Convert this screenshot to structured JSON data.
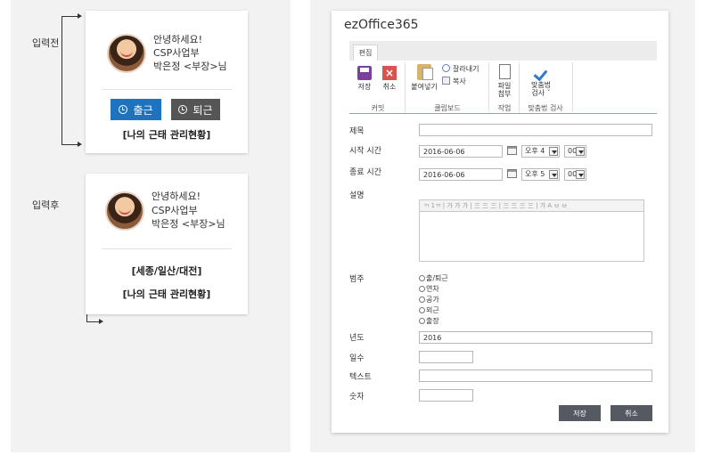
{
  "left": {
    "before_label": "입력전",
    "after_label": "입력후",
    "card_before": {
      "greeting": "안녕하세요!",
      "department": "CSP사업부",
      "user_line": "박은정 <부장>님",
      "clock_in": "출근",
      "clock_out": "퇴근",
      "link": "[나의 근태 관리현황]"
    },
    "card_after": {
      "greeting": "안녕하세요!",
      "department": "CSP사업부",
      "user_line": "박은정 <부장>님",
      "location": "[세종/일산/대전]",
      "link": "[나의 근태 관리현황]"
    }
  },
  "dialog": {
    "title": "ezOffice365",
    "tab": "편집",
    "ribbon": {
      "save": "저장",
      "cancel": "취소",
      "paste": "붙여넣기",
      "cut": "잘라내기",
      "copy": "복사",
      "attach_line1": "파일",
      "attach_line2": "첨부",
      "spell_line1": "맞춤법",
      "spell_line2": "검사 ˇ",
      "group_commit": "커밋",
      "group_clipboard": "클립보드",
      "group_action": "작업",
      "group_spell": "맞춤법 검사"
    },
    "fields": {
      "title_label": "제목",
      "title_value": "",
      "start_label": "시작 시간",
      "start_date": "2016-06-06",
      "start_ampm": "오후 4",
      "start_min": "00",
      "end_label": "종료 시간",
      "end_date": "2016-06-06",
      "end_ampm": "오후 5",
      "end_min": "00",
      "desc_label": "설명",
      "rte_toolbar": "ㄲ 1ㄲ | 가 가 가 | 三 三 三 | 三 三 三 三 | 가 A ㅂ ㅂ",
      "category_label": "범주",
      "category_options": [
        "출/퇴근",
        "연차",
        "공가",
        "외근",
        "출장"
      ],
      "year_label": "년도",
      "year_value": "2016",
      "days_label": "일수",
      "days_value": "",
      "text_label": "텍스트",
      "text_value": "",
      "number_label": "숫자",
      "number_value": ""
    },
    "buttons": {
      "save": "저장",
      "cancel": "취소"
    }
  },
  "colors": {
    "clock_in_button": "#1e73be",
    "clock_out_button": "#555555",
    "dialog_button": "#555a62",
    "ribbon_underline": "#7aa7d6"
  }
}
